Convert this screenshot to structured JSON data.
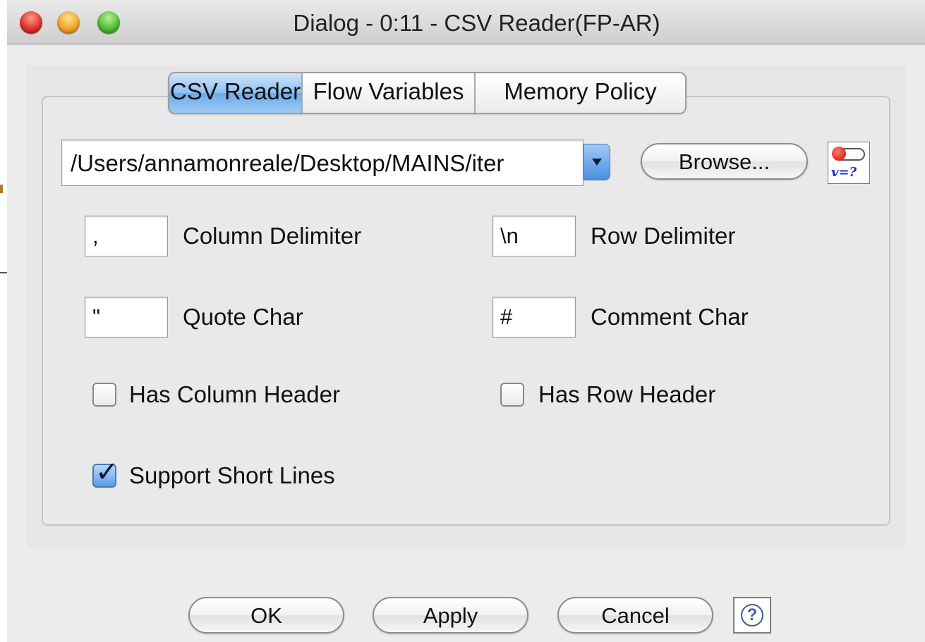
{
  "window": {
    "title": "Dialog - 0:11 - CSV Reader(FP-AR)"
  },
  "tabs": [
    {
      "label": "CSV Reader",
      "active": true
    },
    {
      "label": "Flow Variables",
      "active": false
    },
    {
      "label": "Memory Policy",
      "active": false
    }
  ],
  "file": {
    "path": "/Users/annamonreale/Desktop/MAINS/iter",
    "browse_label": "Browse...",
    "flow_var_icon_text": "v=?"
  },
  "settings": {
    "column_delimiter": {
      "value": ",",
      "label": "Column Delimiter"
    },
    "row_delimiter": {
      "value": "\\n",
      "label": "Row Delimiter"
    },
    "quote_char": {
      "value": "\"",
      "label": "Quote Char"
    },
    "comment_char": {
      "value": "#",
      "label": "Comment Char"
    },
    "has_column_header": {
      "label": "Has Column Header",
      "checked": false
    },
    "has_row_header": {
      "label": "Has Row Header",
      "checked": false
    },
    "support_short_lines": {
      "label": "Support Short Lines",
      "checked": true
    }
  },
  "buttons": {
    "ok": "OK",
    "apply": "Apply",
    "cancel": "Cancel",
    "help_glyph": "?"
  },
  "icons": {
    "close": "close-traffic-light",
    "minimize": "minimize-traffic-light",
    "maximize": "zoom-traffic-light",
    "dropdown": "chevron-down-icon",
    "flow_variable": "flow-variable-icon",
    "help": "help-icon"
  },
  "colors": {
    "active_tab": "#8fc0f2",
    "flow_var_text": "#1a2dd6",
    "flow_var_dot": "#d70000"
  }
}
